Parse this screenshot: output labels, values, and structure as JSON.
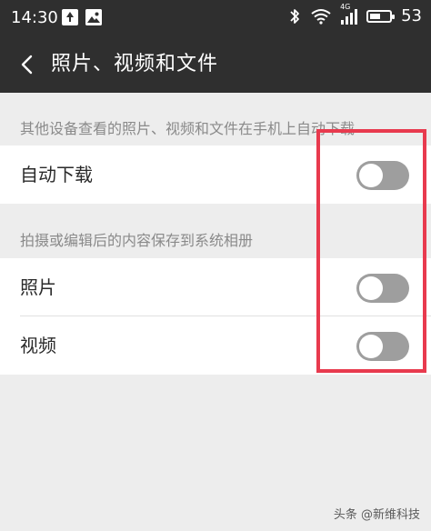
{
  "status_bar": {
    "time": "14:30",
    "network": "4G",
    "battery_level": "53",
    "battery_fill_fraction": 0.53
  },
  "header": {
    "title": "照片、视频和文件",
    "back_icon": "chevron-left-icon"
  },
  "sections": [
    {
      "header": "其他设备查看的照片、视频和文件在手机上自动下载",
      "items": [
        {
          "label": "自动下载",
          "enabled": false
        }
      ]
    },
    {
      "header": "拍摄或编辑后的内容保存到系统相册",
      "items": [
        {
          "label": "照片",
          "enabled": false
        },
        {
          "label": "视频",
          "enabled": false
        }
      ]
    }
  ],
  "watermark": "头条 @新维科技",
  "colors": {
    "bar_background": "#2f2f2f",
    "page_background": "#ededed",
    "toggle_off": "#9e9e9e",
    "highlight": "#e83a4e"
  }
}
